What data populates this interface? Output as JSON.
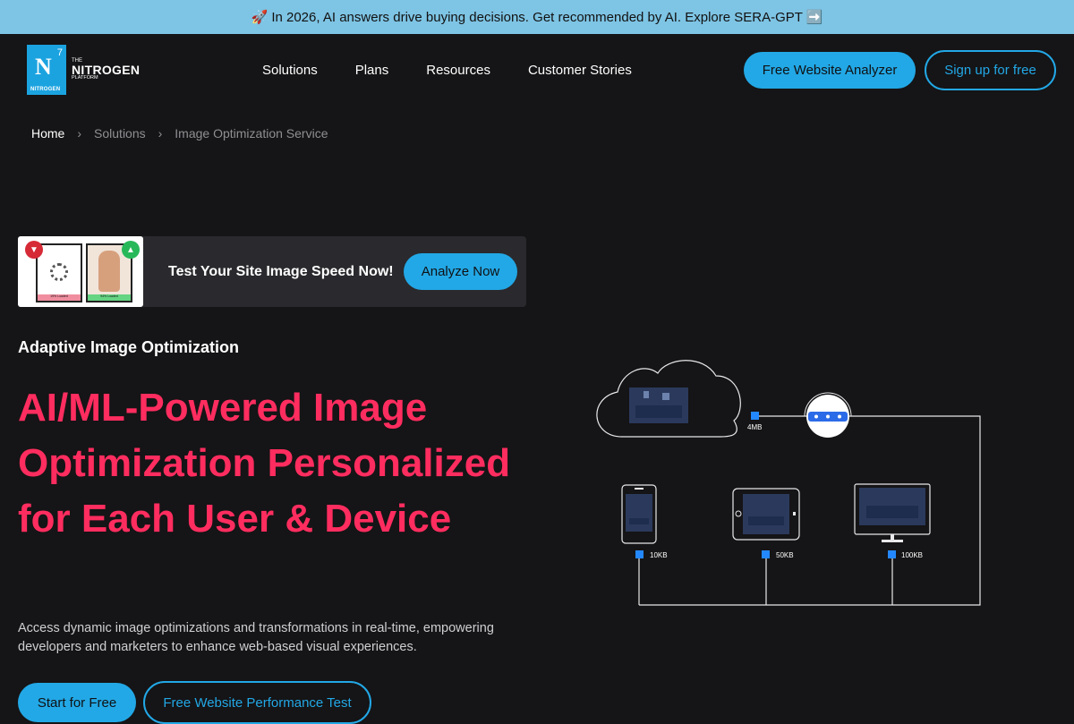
{
  "announcement": {
    "text": "🚀 In 2026, AI answers drive buying decisions. Get recommended by AI. Explore SERA-GPT ➡️"
  },
  "logo": {
    "the": "THE",
    "name": "NITROGEN",
    "platform": "PLATFORM",
    "box_letter": "N",
    "box_super": "7",
    "box_sub": "NITROGEN"
  },
  "nav": {
    "items": [
      "Solutions",
      "Plans",
      "Resources",
      "Customer Stories"
    ]
  },
  "header_buttons": {
    "analyzer": "Free Website Analyzer",
    "signup": "Sign up for free"
  },
  "breadcrumb": {
    "items": [
      "Home",
      "Solutions",
      "Image Optimization Service"
    ],
    "separator": "›"
  },
  "promo": {
    "text": "Test Your Site Image Speed Now!",
    "button": "Analyze Now",
    "thumb_left_caption": "19% Loaded",
    "thumb_right_caption": "94% Loaded"
  },
  "hero": {
    "eyebrow": "Adaptive Image Optimization",
    "headline": "AI/ML-Powered Image Optimization Personalized for Each User & Device",
    "description": "Access dynamic image optimizations and transformations in real-time, empowering developers and marketers to enhance web-based visual experiences.",
    "primary_button": "Start for Free",
    "secondary_button": "Free Website Performance Test"
  },
  "diagram": {
    "source_size": "4MB",
    "devices": [
      {
        "name": "phone",
        "size": "10KB"
      },
      {
        "name": "tablet",
        "size": "50KB"
      },
      {
        "name": "desktop",
        "size": "100KB"
      }
    ]
  },
  "colors": {
    "accent": "#22a8e6",
    "headline": "#ff2d5f",
    "background": "#151416",
    "announce_bg": "#7ec4e4"
  }
}
